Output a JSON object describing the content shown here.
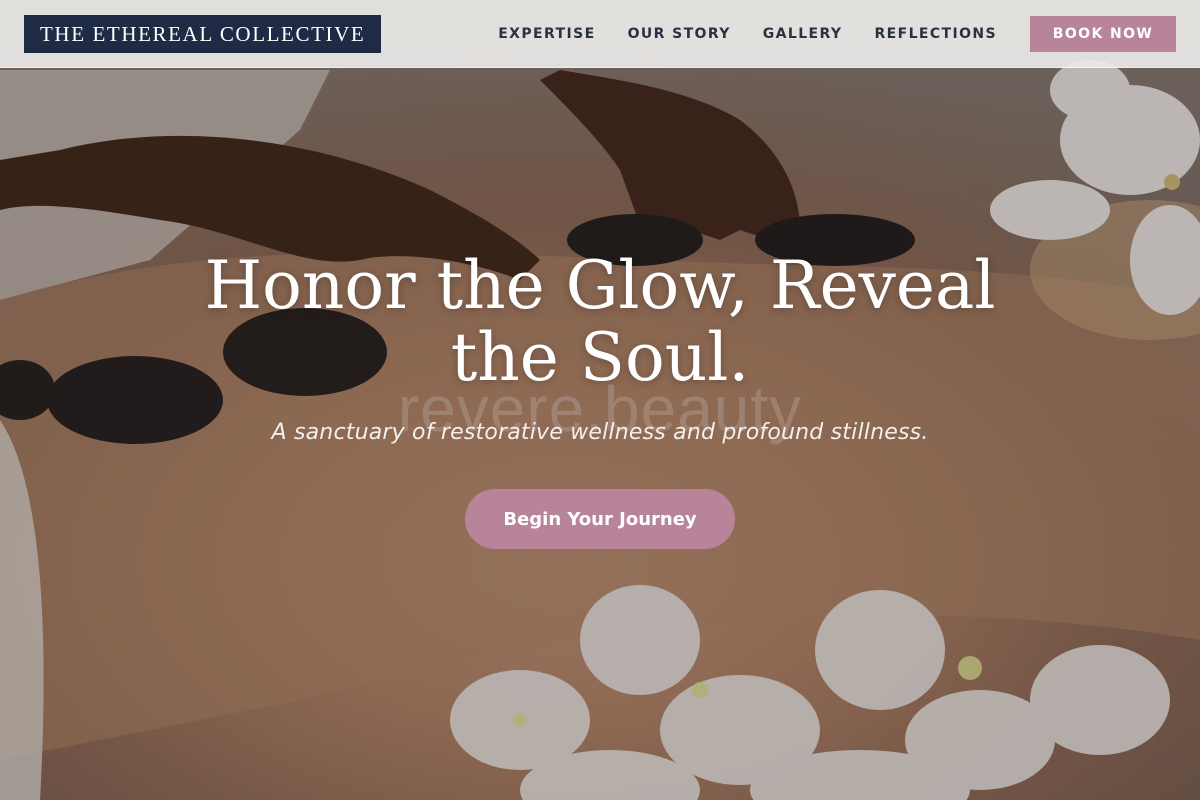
{
  "brand": {
    "name": "THE ETHEREAL COLLECTIVE"
  },
  "nav": {
    "items": [
      "EXPERTISE",
      "OUR STORY",
      "GALLERY",
      "REFLECTIONS"
    ],
    "cta_label": "BOOK NOW"
  },
  "hero": {
    "headline": "Honor the Glow, Reveal the Soul.",
    "watermark": "revere.beauty",
    "tagline": "A sanctuary of restorative wellness and profound stillness.",
    "cta_label": "Begin Your Journey"
  },
  "colors": {
    "logo_bg": "#1f2a44",
    "accent": "#b88499",
    "nav_text": "#2c3142",
    "header_bg": "#eceae8"
  }
}
